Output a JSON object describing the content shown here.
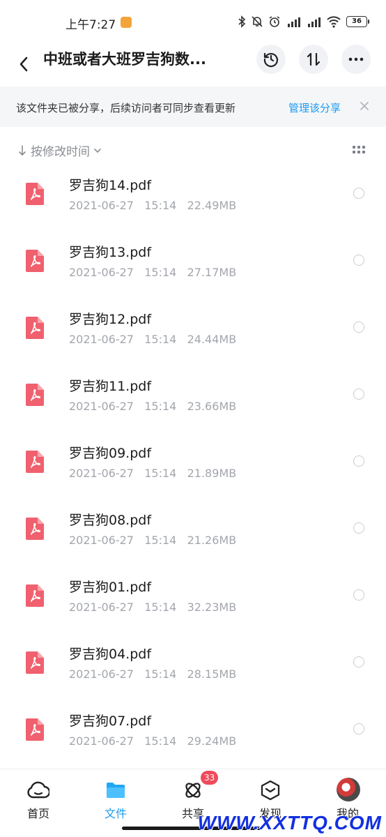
{
  "status_bar": {
    "time": "上午7:27",
    "battery": "36"
  },
  "header": {
    "title": "中班或者大班罗吉狗数..."
  },
  "share_notice": {
    "text": "该文件夹已被分享，后续访问者可同步查看更新",
    "manage_label": "管理该分享"
  },
  "sort": {
    "label": "按修改时间"
  },
  "files": [
    {
      "name": "罗吉狗14.pdf",
      "meta": "2021-06-27   15:14   22.49MB"
    },
    {
      "name": "罗吉狗13.pdf",
      "meta": "2021-06-27   15:14   27.17MB"
    },
    {
      "name": "罗吉狗12.pdf",
      "meta": "2021-06-27   15:14   24.44MB"
    },
    {
      "name": "罗吉狗11.pdf",
      "meta": "2021-06-27   15:14   23.66MB"
    },
    {
      "name": "罗吉狗09.pdf",
      "meta": "2021-06-27   15:14   21.89MB"
    },
    {
      "name": "罗吉狗08.pdf",
      "meta": "2021-06-27   15:14   21.26MB"
    },
    {
      "name": "罗吉狗01.pdf",
      "meta": "2021-06-27   15:14   32.23MB"
    },
    {
      "name": "罗吉狗04.pdf",
      "meta": "2021-06-27   15:14   28.15MB"
    },
    {
      "name": "罗吉狗07.pdf",
      "meta": "2021-06-27   15:14   29.24MB"
    }
  ],
  "nav": {
    "home": "首页",
    "files": "文件",
    "share": "共享",
    "share_badge": "33",
    "discover": "发现",
    "mine": "我的"
  },
  "watermark": "WWW.XXTTQ.COM",
  "colors": {
    "accent": "#1a9bf0",
    "pdf_icon": "#f0606e",
    "badge": "#f04b5b"
  }
}
